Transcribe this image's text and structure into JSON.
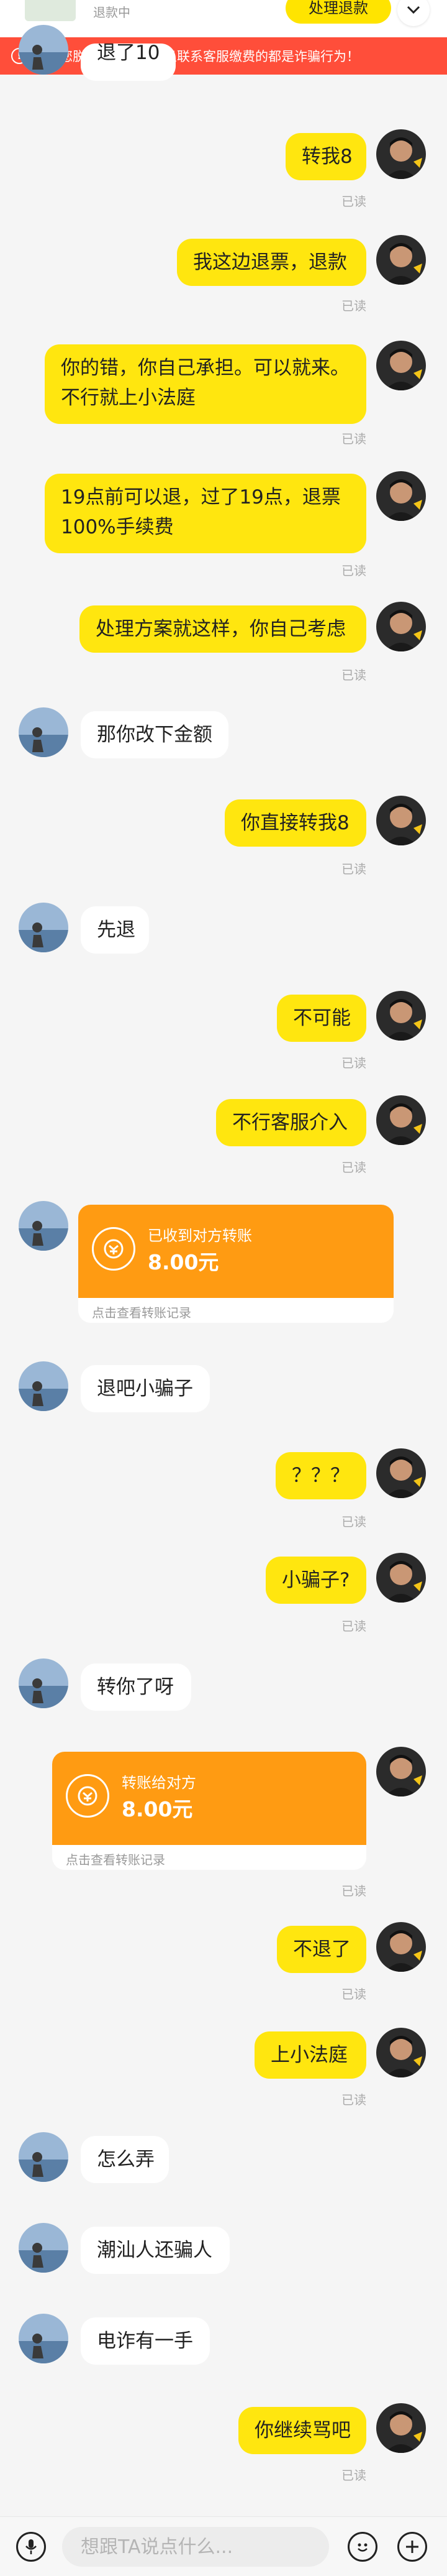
{
  "header": {
    "order_status": "退款中",
    "handle_button": "处理退款"
  },
  "warning": {
    "text": "引导您脱离闲鱼平台并且联系客服缴费的都是诈骗行为！"
  },
  "read_label": "已读",
  "partial_message": "退了10",
  "messages": [
    {
      "side": "me",
      "text": "转我8"
    },
    {
      "side": "me",
      "text": "我这边退票，退款"
    },
    {
      "side": "me",
      "text": "你的错，你自己承担。可以就来。不行就上小法庭"
    },
    {
      "side": "me",
      "text": "19点前可以退，过了19点，退票100%手续费"
    },
    {
      "side": "me",
      "text": "处理方案就这样，你自己考虑"
    },
    {
      "side": "them",
      "text": "那你改下金额"
    },
    {
      "side": "me",
      "text": "你直接转我8"
    },
    {
      "side": "them",
      "text": "先退"
    },
    {
      "side": "me",
      "text": "不可能"
    },
    {
      "side": "me",
      "text": "不行客服介入"
    },
    {
      "side": "them",
      "type": "transfer",
      "title": "已收到对方转账",
      "amount": "8.00元",
      "link": "点击查看转账记录"
    },
    {
      "side": "them",
      "text": "退吧小骗子"
    },
    {
      "side": "me",
      "text": "？？？"
    },
    {
      "side": "me",
      "text": "小骗子?"
    },
    {
      "side": "them",
      "text": "转你了呀"
    },
    {
      "side": "me",
      "type": "transfer",
      "title": "转账给对方",
      "amount": "8.00元",
      "link": "点击查看转账记录"
    },
    {
      "side": "me",
      "text": "不退了"
    },
    {
      "side": "me",
      "text": "上小法庭"
    },
    {
      "side": "them",
      "text": "怎么弄"
    },
    {
      "side": "them",
      "text": "潮汕人还骗人"
    },
    {
      "side": "them",
      "text": "电诈有一手"
    },
    {
      "side": "me",
      "text": "你继续骂吧"
    }
  ],
  "input": {
    "placeholder": "想跟TA说点什么..."
  },
  "colors": {
    "accent_yellow": "#ffe60f",
    "warning_red": "#ff4e3a",
    "transfer_orange": "#ff9b12"
  },
  "icons": [
    "voice-icon",
    "emoji-icon",
    "plus-icon",
    "menu-chevron-icon",
    "warning-icon",
    "transfer-coin-icon"
  ]
}
